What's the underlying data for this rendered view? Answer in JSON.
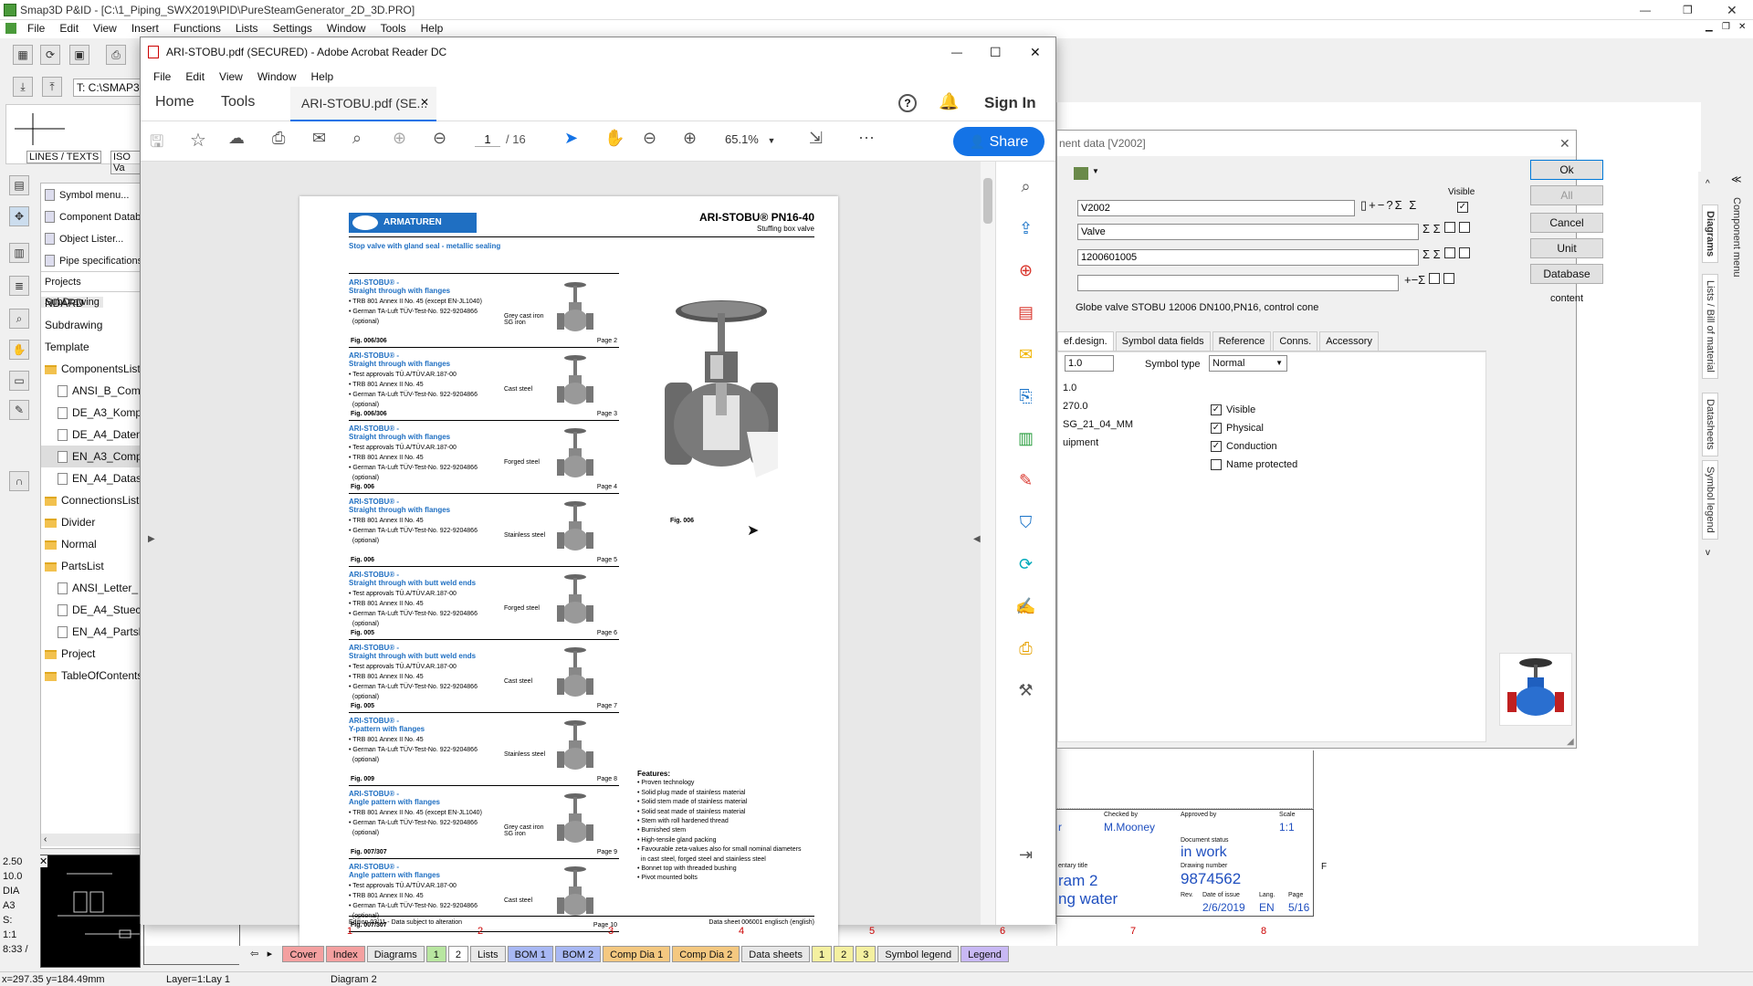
{
  "app": {
    "title": "Smap3D P&ID - [C:\\1_Piping_SWX2019\\PID\\PureSteamGenerator_2D_3D.PRO]",
    "menus": [
      "File",
      "Edit",
      "View",
      "Insert",
      "Functions",
      "Lists",
      "Settings",
      "Window",
      "Tools",
      "Help"
    ],
    "path_field": "T: C:\\SMAP3",
    "lines_texts_label": "LINES / TEXTS",
    "iso_label": "ISO Va",
    "cmd_items": [
      "Symbol menu...",
      "Component Datab",
      "Object Lister...",
      "Pipe specifications"
    ],
    "panel_tabs": [
      "Projects",
      "SubDrawing"
    ],
    "tree": [
      {
        "label": "NDARD",
        "kind": "none"
      },
      {
        "label": "Subdrawing",
        "kind": "none"
      },
      {
        "label": "Template",
        "kind": "none"
      },
      {
        "label": "ComponentsList",
        "kind": "folder"
      },
      {
        "label": "ANSI_B_Com",
        "kind": "doc"
      },
      {
        "label": "DE_A3_Komp",
        "kind": "doc"
      },
      {
        "label": "DE_A4_Daten",
        "kind": "doc"
      },
      {
        "label": "EN_A3_Comp",
        "kind": "doc"
      },
      {
        "label": "EN_A4_Datas",
        "kind": "doc"
      },
      {
        "label": "ConnectionsList",
        "kind": "folder"
      },
      {
        "label": "Divider",
        "kind": "folder"
      },
      {
        "label": "Normal",
        "kind": "folder"
      },
      {
        "label": "PartsList",
        "kind": "folder"
      },
      {
        "label": "ANSI_Letter_",
        "kind": "doc"
      },
      {
        "label": "DE_A4_Stuec",
        "kind": "doc"
      },
      {
        "label": "EN_A4_Partsl",
        "kind": "doc"
      },
      {
        "label": "Project",
        "kind": "folder"
      },
      {
        "label": "TableOfContents",
        "kind": "folder"
      }
    ],
    "scale_values": [
      "2.50",
      "10.0",
      "DIA",
      "A3",
      "S:",
      "1:1",
      "8:33 /"
    ],
    "status": {
      "coords": "x=297.35 y=184.49mm",
      "layer": "Layer=1:Lay 1",
      "drawing": "Diagram 2"
    },
    "sheet_tabs": [
      {
        "label": "Cover",
        "color": "#f4a0a0"
      },
      {
        "label": "Index",
        "color": "#f4a0a0"
      },
      {
        "label": "Diagrams",
        "color": "#e8e8e8"
      },
      {
        "label": "1",
        "color": "#b8e6a0"
      },
      {
        "label": "2",
        "color": "#ffffff"
      },
      {
        "label": "Lists",
        "color": "#e8e8e8"
      },
      {
        "label": "BOM 1",
        "color": "#a8b8f4"
      },
      {
        "label": "BOM 2",
        "color": "#a8b8f4"
      },
      {
        "label": "Comp Dia 1",
        "color": "#f4c880"
      },
      {
        "label": "Comp Dia 2",
        "color": "#f4c880"
      },
      {
        "label": "Data sheets",
        "color": "#e8e8e8"
      },
      {
        "label": "1",
        "color": "#f4f0a0"
      },
      {
        "label": "2",
        "color": "#f4f0a0"
      },
      {
        "label": "3",
        "color": "#f4f0a0"
      },
      {
        "label": "Symbol legend",
        "color": "#e8e8e8"
      },
      {
        "label": "Legend",
        "color": "#c8b8f4"
      }
    ],
    "right_tabs": [
      "Component menu",
      "Diagrams",
      "Lists / Bill of material",
      "Datasheets",
      "Symbol legend"
    ]
  },
  "acrobat": {
    "title": "ARI-STOBU.pdf (SECURED) - Adobe Acrobat Reader DC",
    "menus": [
      "File",
      "Edit",
      "View",
      "Window",
      "Help"
    ],
    "tabs": {
      "home": "Home",
      "tools": "Tools",
      "doc": "ARI-STOBU.pdf (SE..."
    },
    "sign_in": "Sign In",
    "page_current": "1",
    "page_total": "/ 16",
    "zoom": "65.1%",
    "share": "Share"
  },
  "pdf": {
    "brand": "ARMATUREN",
    "heading": "ARI-STOBU® PN16-40",
    "subheading": "Stuffing box valve",
    "tagline": "Stop valve with gland seal - metallic sealing",
    "rows": [
      {
        "t1": "ARI-STOBU® -",
        "t2": "Straight through with flanges",
        "b": [
          "• TRB 801 Annex II No. 45 (except EN-JL1040)",
          "• German TA-Luft TÜV-Test-No. 922-9204866",
          "  (optional)"
        ],
        "mat": "Grey cast iron\nSG iron",
        "fig": "Fig. 006/306",
        "pg": "Page 2"
      },
      {
        "t1": "ARI-STOBU® -",
        "t2": "Straight through with flanges",
        "b": [
          "• Test approvals TÜ.A/TÜV.AR.187-00",
          "• TRB 801 Annex II No. 45",
          "• German TA-Luft TÜV-Test-No. 922-9204866",
          "  (optional)"
        ],
        "mat": "Cast steel",
        "fig": "Fig. 006/306",
        "pg": "Page 3"
      },
      {
        "t1": "ARI-STOBU® -",
        "t2": "Straight through with flanges",
        "b": [
          "• Test approvals TÜ.A/TÜV.AR.187-00",
          "• TRB 801 Annex II No. 45",
          "• German TA-Luft TÜV-Test-No. 922-9204866",
          "  (optional)"
        ],
        "mat": "Forged steel",
        "fig": "Fig. 006",
        "pg": "Page 4"
      },
      {
        "t1": "ARI-STOBU® -",
        "t2": "Straight through with flanges",
        "b": [
          "• TRB 801 Annex II No. 45",
          "• German TA-Luft TÜV-Test-No. 922-9204866",
          "  (optional)"
        ],
        "mat": "Stainless steel",
        "fig": "Fig. 006",
        "pg": "Page 5"
      },
      {
        "t1": "ARI-STOBU® -",
        "t2": "Straight through with butt weld ends",
        "b": [
          "• Test approvals TÜ.A/TÜV.AR.187-00",
          "• TRB 801 Annex II No. 45",
          "• German TA-Luft TÜV-Test-No. 922-9204866",
          "  (optional)"
        ],
        "mat": "Forged steel",
        "fig": "Fig. 005",
        "pg": "Page 6"
      },
      {
        "t1": "ARI-STOBU® -",
        "t2": "Straight through with butt weld ends",
        "b": [
          "• Test approvals TÜ.A/TÜV.AR.187-00",
          "• TRB 801 Annex II No. 45",
          "• German TA-Luft TÜV-Test-No. 922-9204866",
          "  (optional)"
        ],
        "mat": "Cast steel",
        "fig": "Fig. 005",
        "pg": "Page 7"
      },
      {
        "t1": "ARI-STOBU® -",
        "t2": "Y-pattern with flanges",
        "b": [
          "• TRB 801 Annex II No. 45",
          "• German TA-Luft TÜV-Test-No. 922-9204866",
          "  (optional)"
        ],
        "mat": "Stainless steel",
        "fig": "Fig. 009",
        "pg": "Page 8"
      },
      {
        "t1": "ARI-STOBU® -",
        "t2": "Angle pattern with flanges",
        "b": [
          "• TRB 801 Annex II No. 45 (except EN-JL1040)",
          "• German TA-Luft TÜV-Test-No. 922-9204866",
          "  (optional)"
        ],
        "mat": "Grey cast iron\nSG iron",
        "fig": "Fig. 007/307",
        "pg": "Page 9"
      },
      {
        "t1": "ARI-STOBU® -",
        "t2": "Angle pattern with flanges",
        "b": [
          "• Test approvals TÜ.A/TÜV.AR.187-00",
          "• TRB 801 Annex II No. 45",
          "• German TA-Luft TÜV-Test-No. 922-9204866",
          "  (optional)"
        ],
        "mat": "Cast steel",
        "fig": "Fig. 007/307",
        "pg": "Page 10"
      }
    ],
    "fig_caption": "Fig. 006",
    "features_title": "Features:",
    "features": [
      "• Proven technology",
      "• Solid plug made of stainless material",
      "• Solid stem made of stainless material",
      "• Solid seat made of stainless material",
      "• Stem with roll hardened thread",
      "• Burnished stem",
      "• High-tensile gland packing",
      "• Favourable zeta-values also for small nominal diameters",
      "  in cast steel, forged steel and stainless steel",
      "• Bonnet top with threaded bushing",
      "• Pivot mounted bolts"
    ],
    "footer_left": "Edition 03/11 - Data subject to alteration",
    "footer_right": "Data sheet 006001 englisch (english)"
  },
  "component_dialog": {
    "title": "nent data [V2002]",
    "visible_label": "Visible",
    "field1": "V2002",
    "field2": "Valve",
    "field3": "1200601005",
    "field4": "",
    "description": "Globe valve STOBU 12006 DN100,PN16, control cone",
    "buttons": {
      "ok": "Ok",
      "all": "All",
      "cancel": "Cancel",
      "unit": "Unit",
      "database": "Database"
    },
    "content_label": "content",
    "tabs": [
      "ef.design.",
      "Symbol data fields",
      "Reference",
      "Conns.",
      "Accessory"
    ],
    "scale_value": "1.0",
    "symbol_type_label": "Symbol type",
    "symbol_type_value": "Normal",
    "values": [
      "1.0",
      "270.0",
      "SG_21_04_MM",
      "uipment"
    ],
    "checks": [
      {
        "label": "Visible",
        "checked": true
      },
      {
        "label": "Physical",
        "checked": true
      },
      {
        "label": "Conduction",
        "checked": true
      },
      {
        "label": "Name protected",
        "checked": false
      }
    ]
  },
  "title_block": {
    "checked_by_label": "Checked by",
    "checked_by": "M.Mooney",
    "approved_by_label": "Approved by",
    "scale_label": "Scale",
    "scale": "1:1",
    "left_char": "r",
    "doc_status_label": "Document status",
    "doc_status": "in work",
    "drawing_title_label": "entary title",
    "drawing_no_label": "Drawing number",
    "drawing_no": "9874562",
    "title_line1": "ram 2",
    "title_line2": "ng water",
    "rev_label": "Rev.",
    "date_label": "Date of issue",
    "date": "2/6/2019",
    "lang_label": "Lang.",
    "lang": "EN",
    "page_label": "Page",
    "page": "5/16",
    "f_mark": "F",
    "grid_numbers": [
      "1",
      "2",
      "3",
      "4",
      "5",
      "6",
      "7",
      "8"
    ]
  }
}
